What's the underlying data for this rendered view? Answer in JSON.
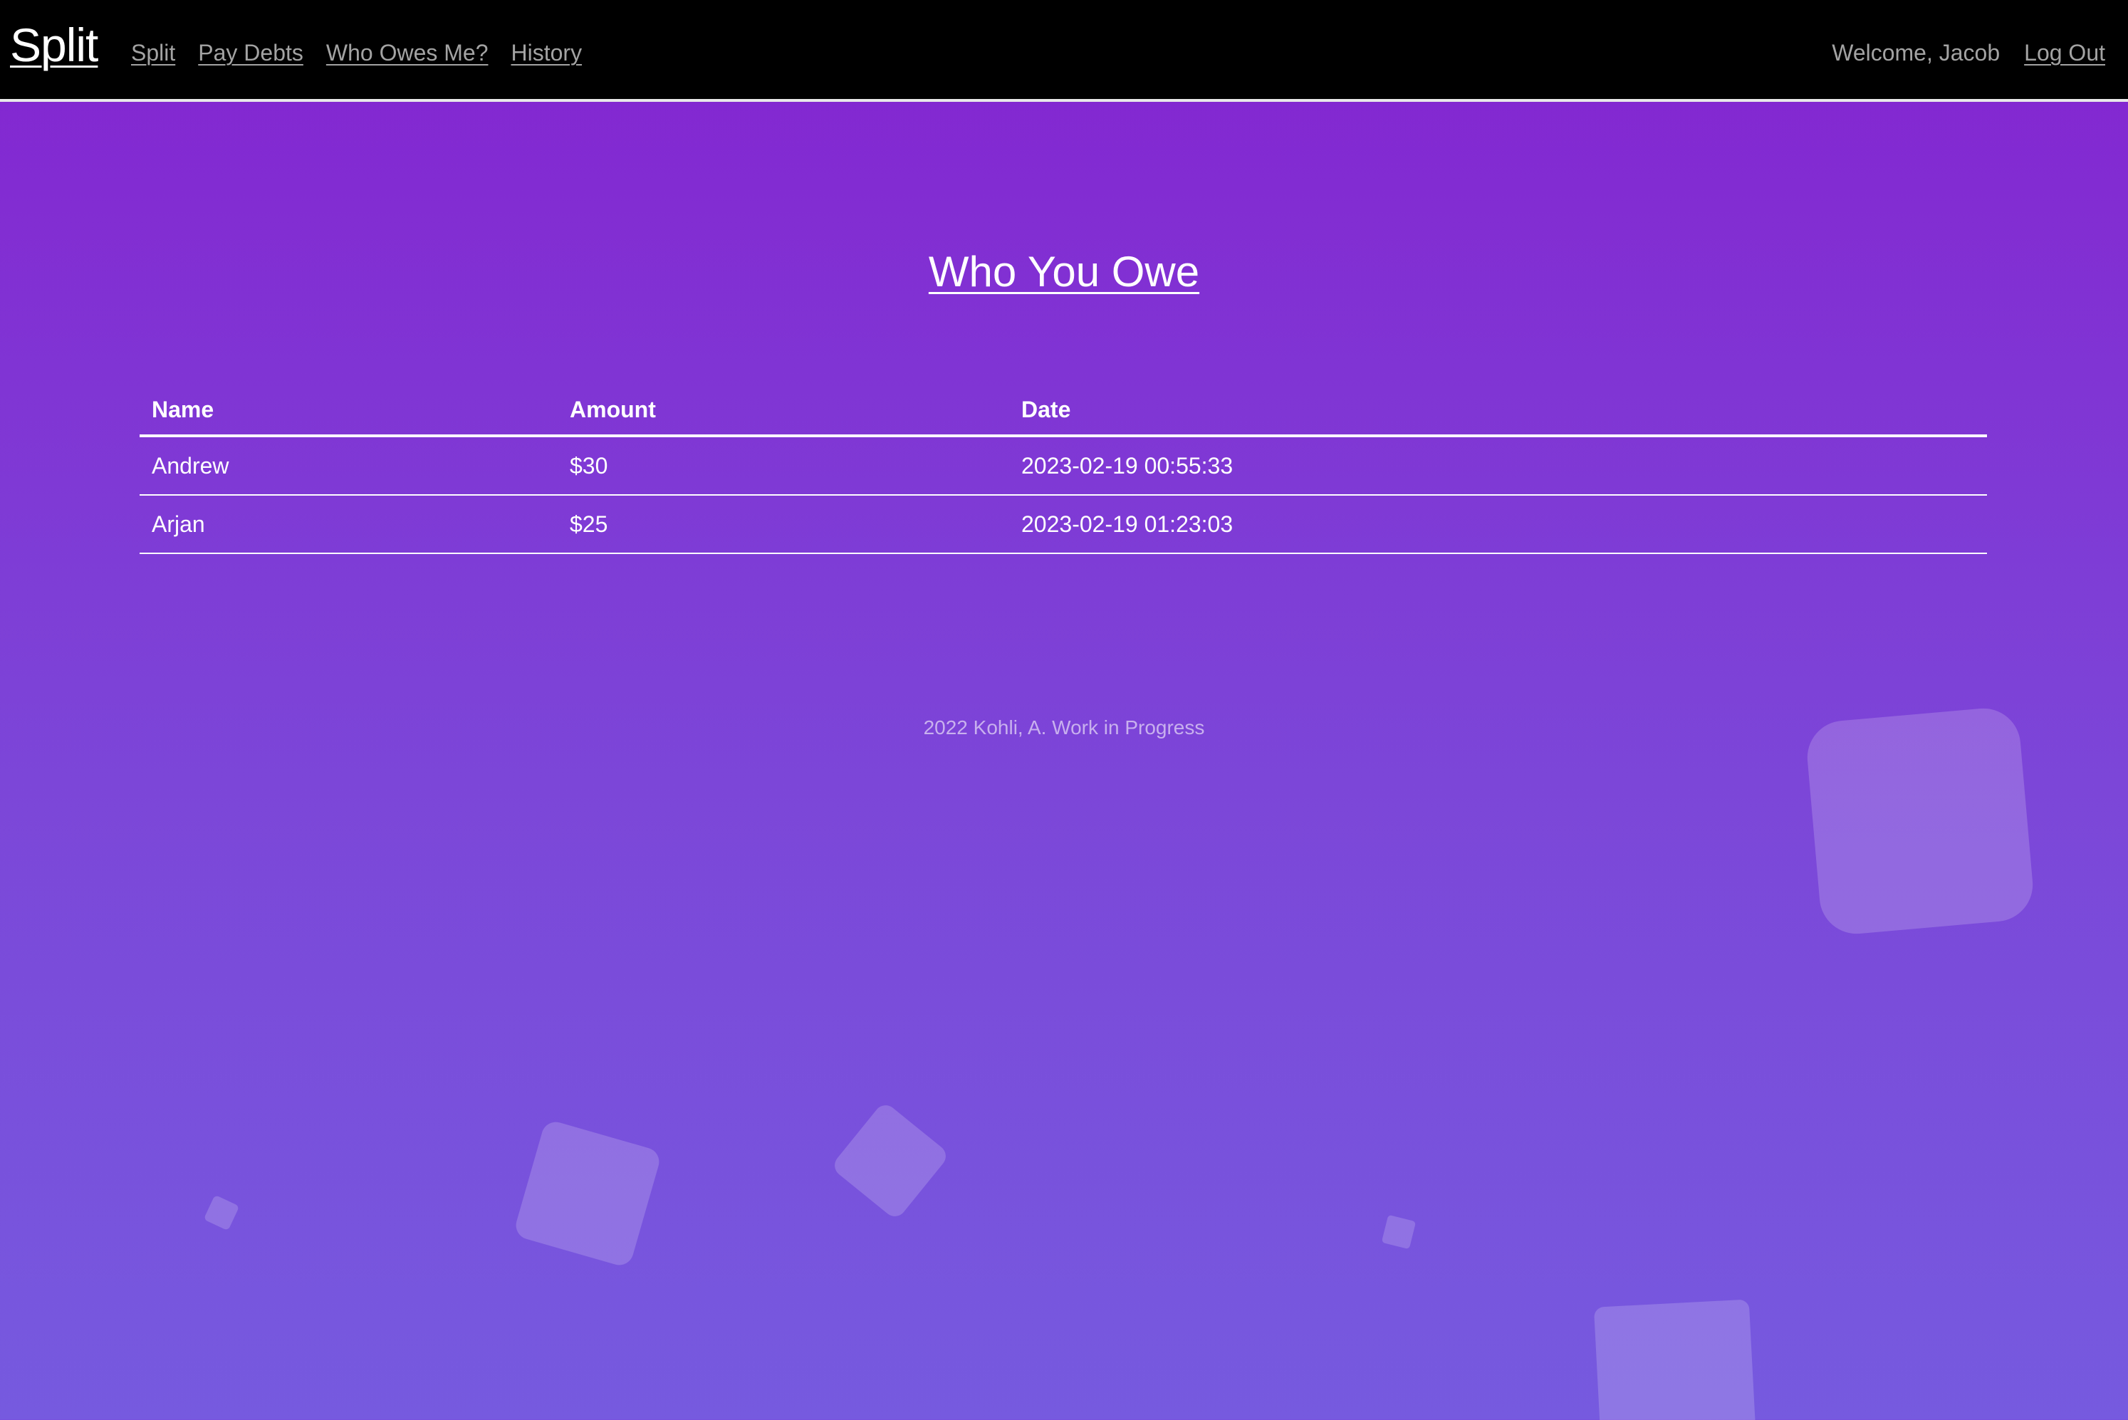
{
  "header": {
    "brand": "Split",
    "nav": [
      "Split",
      "Pay Debts",
      "Who Owes Me?",
      "History"
    ],
    "welcome": "Welcome, Jacob",
    "logout": "Log Out"
  },
  "main": {
    "title": "Who You Owe",
    "table": {
      "columns": [
        "Name",
        "Amount",
        "Date"
      ],
      "rows": [
        {
          "name": "Andrew",
          "amount": "$30",
          "date": "2023-02-19 00:55:33"
        },
        {
          "name": "Arjan",
          "amount": "$25",
          "date": "2023-02-19 01:23:03"
        }
      ]
    }
  },
  "footer": {
    "text": "2022 Kohli, A. Work in Progress"
  },
  "colors": {
    "navbar_bg": "#000000",
    "gradient_top": "#8424d0",
    "gradient_bottom": "#765adf",
    "nav_link": "#a3a3a3"
  }
}
